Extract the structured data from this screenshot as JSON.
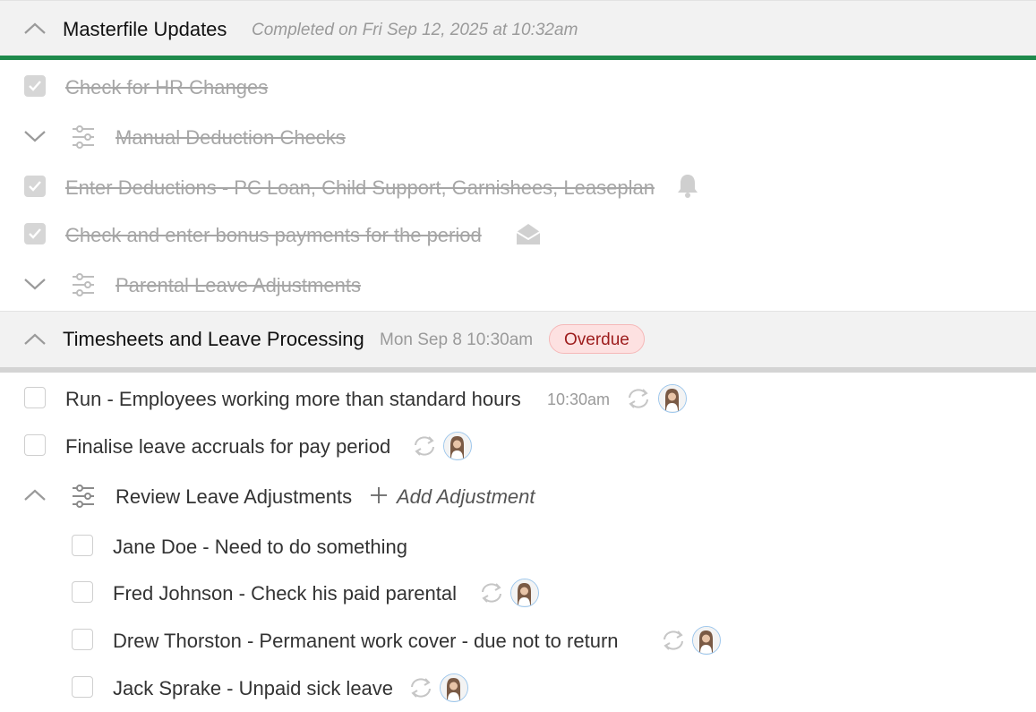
{
  "sections": [
    {
      "title": "Masterfile Updates",
      "subtitle": "Completed on Fri Sep 12, 2025 at 10:32am",
      "accent": "#1f8a4c",
      "items": [
        {
          "label": "Check for HR Changes"
        },
        {
          "label": "Manual Deduction Checks"
        },
        {
          "label": "Enter Deductions - PC Loan, Child Support, Garnishees, Leaseplan"
        },
        {
          "label": "Check and enter bonus payments for the period"
        },
        {
          "label": "Parental Leave Adjustments"
        }
      ]
    },
    {
      "title": "Timesheets and Leave Processing",
      "subtitle": "Mon Sep 8 10:30am",
      "badge": "Overdue",
      "badge_color": "#9d1c1c",
      "items": [
        {
          "label": "Run - Employees working more than standard hours",
          "time": "10:30am"
        },
        {
          "label": "Finalise leave accruals for pay period"
        },
        {
          "label": "Review Leave Adjustments",
          "action": "Add Adjustment"
        }
      ],
      "subitems": [
        {
          "label": "Jane Doe - Need to do something"
        },
        {
          "label": "Fred Johnson - Check his paid parental"
        },
        {
          "label": "Drew Thorston - Permanent work cover - due not to return"
        },
        {
          "label": "Jack Sprake - Unpaid sick leave"
        }
      ]
    }
  ]
}
